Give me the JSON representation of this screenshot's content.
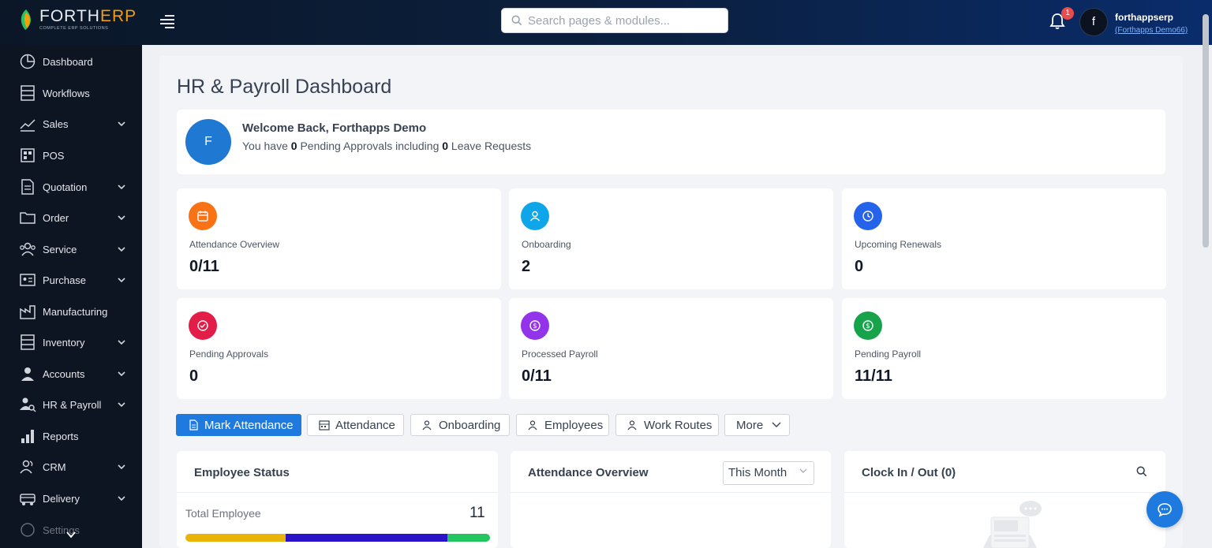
{
  "topbar": {
    "logo_prefix": "FORTH",
    "logo_suffix": "ERP",
    "logo_tagline": "COMPLETE ERP SOLUTIONS",
    "search_placeholder": "Search pages & modules...",
    "notification_count": "1",
    "user_initial": "f",
    "user_name": "forthappserp",
    "user_company": "(Forthapps Demo66)"
  },
  "sidebar": {
    "items": [
      {
        "label": "Dashboard",
        "icon": "pie-chart-icon",
        "has_submenu": false
      },
      {
        "label": "Workflows",
        "icon": "list-icon",
        "has_submenu": false
      },
      {
        "label": "Sales",
        "icon": "trend-icon",
        "has_submenu": true
      },
      {
        "label": "POS",
        "icon": "pos-icon",
        "has_submenu": false
      },
      {
        "label": "Quotation",
        "icon": "document-icon",
        "has_submenu": true
      },
      {
        "label": "Order",
        "icon": "folder-icon",
        "has_submenu": true
      },
      {
        "label": "Service",
        "icon": "people-icon",
        "has_submenu": true
      },
      {
        "label": "Purchase",
        "icon": "id-card-icon",
        "has_submenu": true
      },
      {
        "label": "Manufacturing",
        "icon": "factory-icon",
        "has_submenu": false
      },
      {
        "label": "Inventory",
        "icon": "list-icon",
        "has_submenu": true
      },
      {
        "label": "Accounts",
        "icon": "user-icon",
        "has_submenu": true
      },
      {
        "label": "HR & Payroll",
        "icon": "user-search-icon",
        "has_submenu": true
      },
      {
        "label": "Reports",
        "icon": "bar-chart-icon",
        "has_submenu": false
      },
      {
        "label": "CRM",
        "icon": "people-icon",
        "has_submenu": true
      },
      {
        "label": "Delivery",
        "icon": "truck-icon",
        "has_submenu": true
      },
      {
        "label": "Settings",
        "icon": "gear-icon",
        "has_submenu": false
      }
    ]
  },
  "page": {
    "title": "HR & Payroll Dashboard"
  },
  "welcome": {
    "initial": "F",
    "title": "Welcome Back, Forthapps Demo",
    "sub_prefix": "You have ",
    "pending_count": "0",
    "sub_middle": " Pending Approvals including ",
    "leave_count": "0",
    "sub_suffix": " Leave Requests"
  },
  "cards": [
    {
      "label": "Attendance Overview",
      "value": "0/11",
      "color": "#f97316",
      "icon": "calendar-icon"
    },
    {
      "label": "Onboarding",
      "value": "2",
      "color": "#0ea5e9",
      "icon": "user-icon"
    },
    {
      "label": "Upcoming Renewals",
      "value": "0",
      "color": "#2563eb",
      "icon": "clock-icon"
    },
    {
      "label": "Pending Approvals",
      "value": "0",
      "color": "#e11d48",
      "icon": "check-circle-icon"
    },
    {
      "label": "Processed Payroll",
      "value": "0/11",
      "color": "#9333ea",
      "icon": "dollar-icon"
    },
    {
      "label": "Pending Payroll",
      "value": "11/11",
      "color": "#16a34a",
      "icon": "dollar-icon"
    }
  ],
  "tabs": [
    {
      "label": "Mark Attendance",
      "active": true
    },
    {
      "label": "Attendance",
      "active": false
    },
    {
      "label": "Onboarding",
      "active": false
    },
    {
      "label": "Employees",
      "active": false
    },
    {
      "label": "Work Routes",
      "active": false
    },
    {
      "label": "More",
      "active": false
    }
  ],
  "panels": {
    "employee_status": {
      "title": "Employee Status",
      "total_label": "Total Employee",
      "total_value": "11",
      "bar_segments": [
        {
          "fraction": 0.33,
          "color": "#eab308"
        },
        {
          "fraction": 0.53,
          "color": "#2a12c9"
        },
        {
          "fraction": 0.14,
          "color": "#22c55e"
        }
      ]
    },
    "attendance_overview": {
      "title": "Attendance Overview",
      "period": "This Month"
    },
    "clock": {
      "title": "Clock In / Out (0)"
    }
  }
}
